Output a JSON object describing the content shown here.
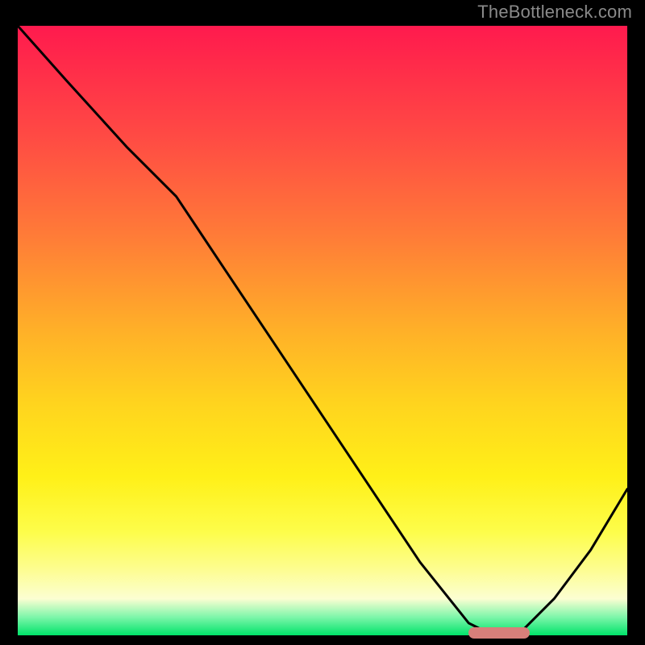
{
  "watermark": {
    "text": "TheBottleneck.com"
  },
  "chart_data": {
    "type": "line",
    "title": "",
    "xlabel": "",
    "ylabel": "",
    "xlim": [
      0,
      100
    ],
    "ylim": [
      0,
      100
    ],
    "grid": false,
    "legend": false,
    "background": "vertical-gradient red→orange→yellow→green",
    "series": [
      {
        "name": "bottleneck-curve",
        "x": [
          0,
          8,
          18,
          26,
          34,
          42,
          50,
          58,
          66,
          74,
          78,
          82,
          88,
          94,
          100
        ],
        "values": [
          100,
          91,
          80,
          72,
          60,
          48,
          36,
          24,
          12,
          2,
          0,
          0,
          6,
          14,
          24
        ]
      }
    ],
    "annotations": [
      {
        "name": "optimal-marker",
        "type": "pill",
        "x_start": 74,
        "x_end": 84,
        "y": 0,
        "color": "#d87f7a"
      }
    ],
    "gradient_stops": [
      {
        "pct": 0,
        "color": "#ff1a4e"
      },
      {
        "pct": 50,
        "color": "#ffb028"
      },
      {
        "pct": 85,
        "color": "#fdfd8e"
      },
      {
        "pct": 100,
        "color": "#00e36a"
      }
    ]
  }
}
